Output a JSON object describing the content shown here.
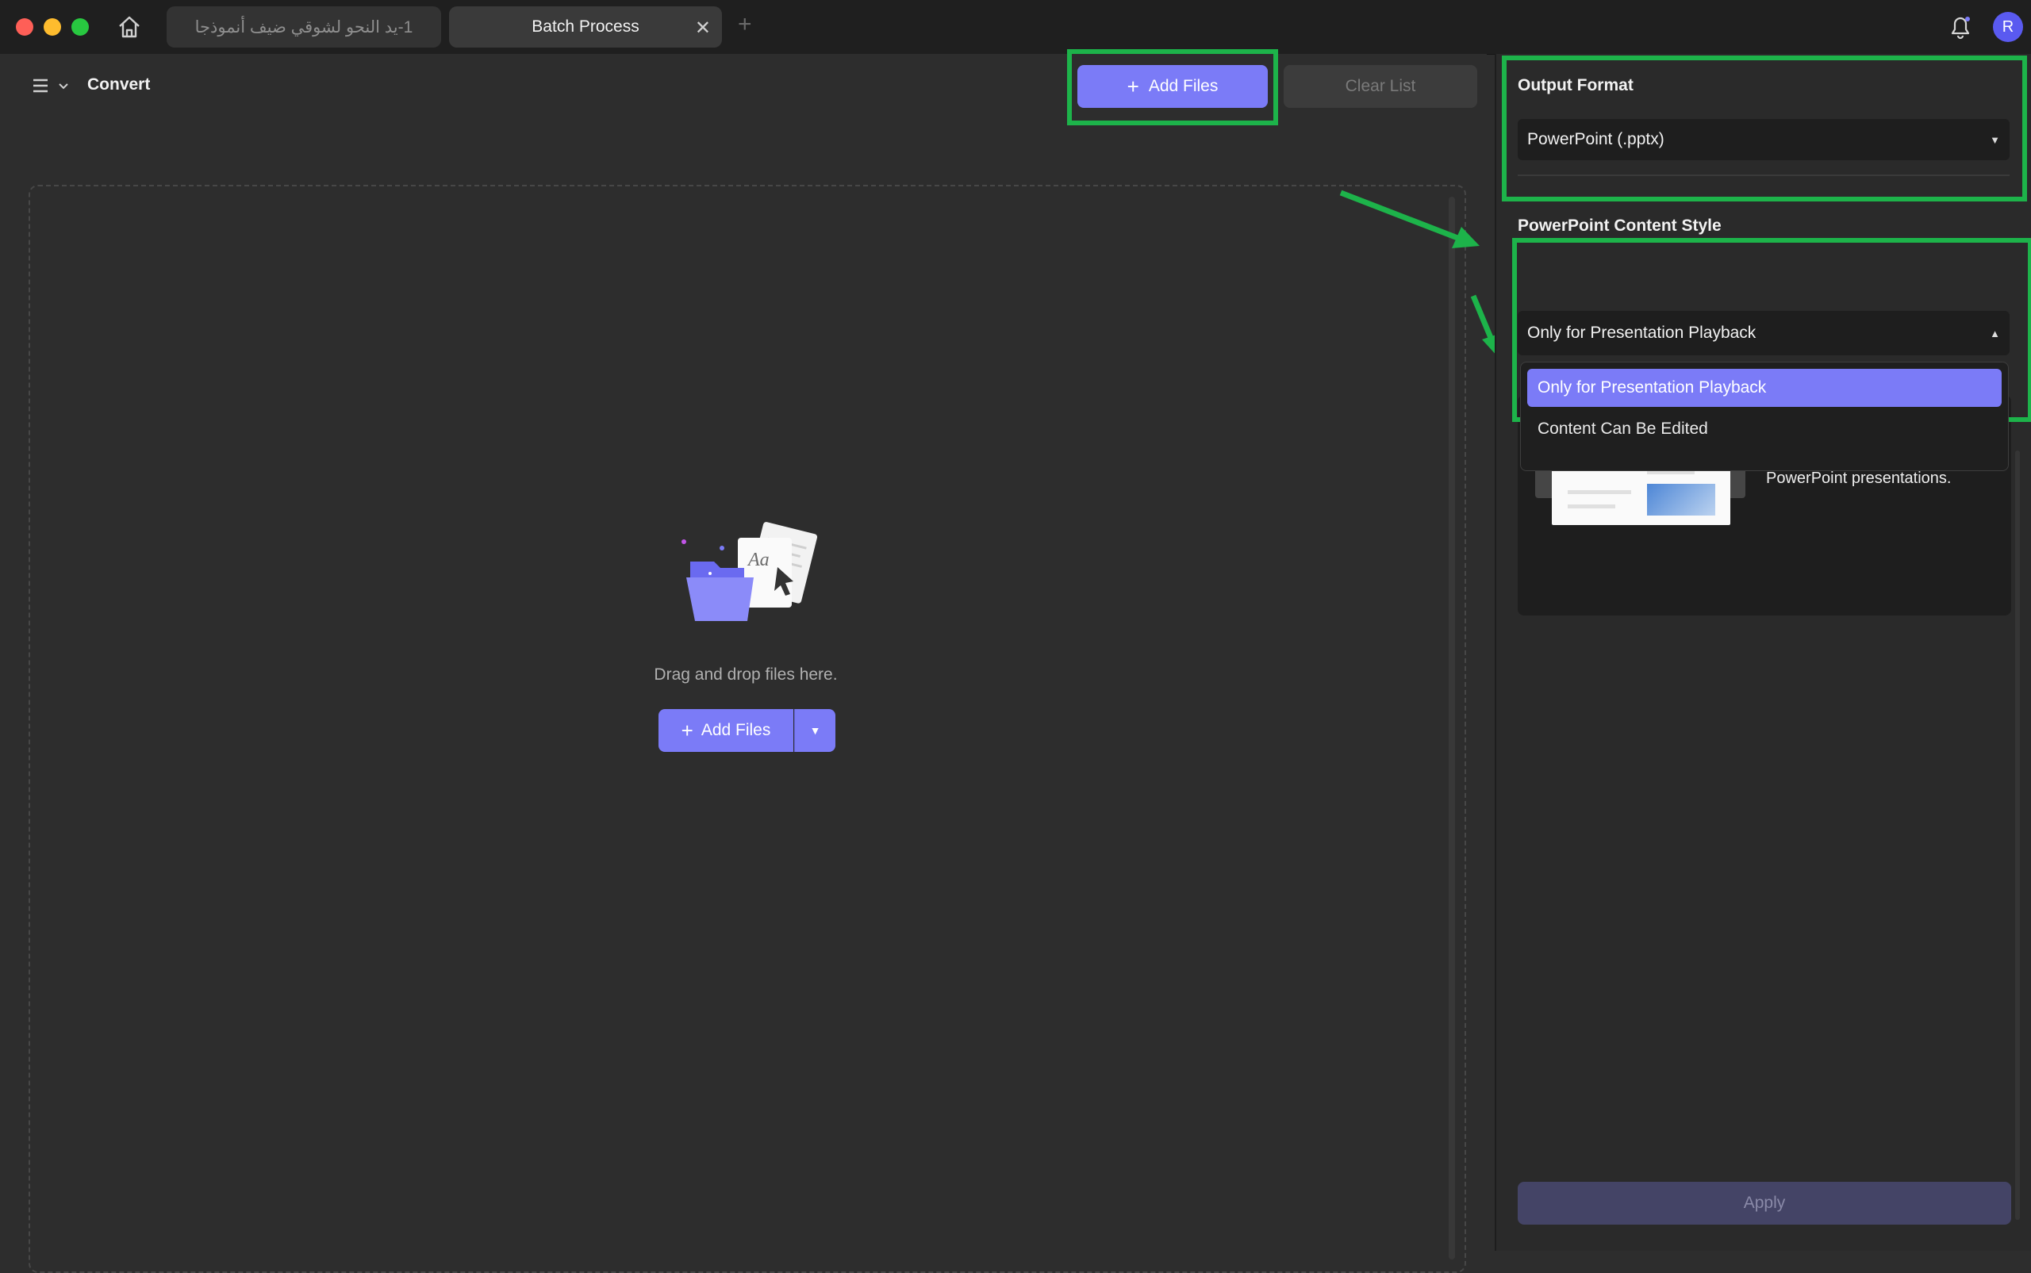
{
  "window": {
    "tabs": [
      {
        "label": "1-يد النحو لشوقي ضيف أنموذجا",
        "active": false
      },
      {
        "label": "Batch Process",
        "active": true
      }
    ],
    "avatar_initial": "R"
  },
  "toolbar": {
    "mode_label": "Convert",
    "add_files_label": "Add Files",
    "clear_list_label": "Clear List"
  },
  "dropzone": {
    "hint": "Drag and drop files here.",
    "add_files_label": "Add Files"
  },
  "sidebar": {
    "output_format_label": "Output Format",
    "output_format_value": "PowerPoint (.pptx)",
    "content_style_label": "PowerPoint Content Style",
    "content_style_value": "Only for Presentation Playback",
    "content_style_options": [
      "Only for Presentation Playback",
      "Content Can Be Edited"
    ],
    "preview_description": "preserve the original document's style, commonly used for PowerPoint presentations.",
    "preview_thumb_text": "Aa",
    "apply_label": "Apply"
  },
  "colors": {
    "accent": "#7b7bf7",
    "highlight": "#1db34a",
    "background": "#2d2d2d"
  },
  "icons": [
    "home-icon",
    "close-icon",
    "plus-icon",
    "menu-icon",
    "chevron-down-icon",
    "bell-icon",
    "folder-illustration"
  ]
}
